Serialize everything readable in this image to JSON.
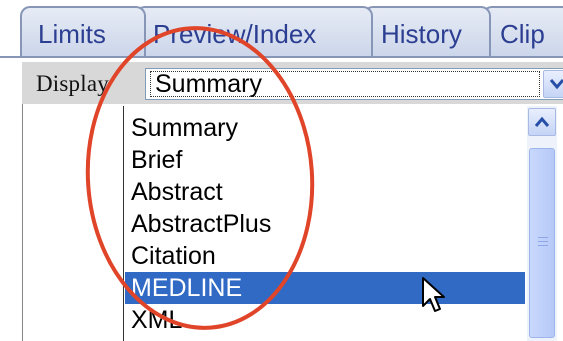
{
  "tabs": [
    {
      "label": "Limits"
    },
    {
      "label": "Preview/Index"
    },
    {
      "label": "History"
    },
    {
      "label": "Clip"
    }
  ],
  "display": {
    "label": "Display",
    "selected_value": "Summary"
  },
  "dropdown": {
    "options": [
      {
        "label": "Summary"
      },
      {
        "label": "Brief"
      },
      {
        "label": "Abstract"
      },
      {
        "label": "AbstractPlus"
      },
      {
        "label": "Citation"
      },
      {
        "label": "MEDLINE"
      },
      {
        "label": "XML"
      }
    ],
    "highlighted": "MEDLINE"
  },
  "colors": {
    "tab_text": "#2b3e92",
    "highlight": "#316ac5",
    "annotation": "#e0452a"
  },
  "icons": [
    "chevron-down-icon",
    "scroll-up-arrow-icon",
    "mouse-pointer-icon"
  ]
}
